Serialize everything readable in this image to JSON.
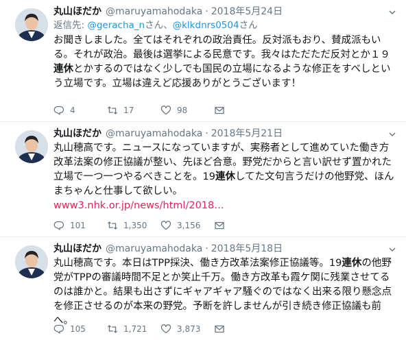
{
  "tweets": [
    {
      "name": "丸山ほだか",
      "handle": "@maruyamahodaka",
      "separator": "·",
      "date": "2018年5月24日",
      "reply_prefix": "返信先: ",
      "reply_mention_1": "@geracha_n",
      "reply_mid": "さん、",
      "reply_mention_2": "@klkdnrs0504",
      "reply_suffix": "さん",
      "text_1": "お聞きしました。全てはそれぞれの政治責任。反対派もおり、賛成派もいる。それが政治。最後は選挙による民意です。我々はただただ反対とか１９",
      "text_bold": "連休",
      "text_2": "とかするのではなく少しでも国民の立場になるような修正をすべしという立場です。立場は違えど応援ありがとうございます！",
      "link": "",
      "replies": "4",
      "retweets": "17",
      "likes": "98"
    },
    {
      "name": "丸山ほだか",
      "handle": "@maruyamahodaka",
      "separator": "·",
      "date": "2018年5月21日",
      "text_1": "丸山穂高です。ニュースになっていますが、実務者として進めていた働き方改革法案の修正協議が整い、先ほど合意。野党だからと言い訳せず置かれた立場で一つ一つやるべきことを。19",
      "text_bold": "連休",
      "text_2": "してた文句言うだけの他野党、ほんまちゃんと仕事して欲しい。",
      "link": "www3.nhk.or.jp/news/html/2018…",
      "replies": "101",
      "retweets": "1,350",
      "likes": "3,156"
    },
    {
      "name": "丸山ほだか",
      "handle": "@maruyamahodaka",
      "separator": "·",
      "date": "2018年5月18日",
      "text_1": "丸山穂高です。本日はTPP採決、働き方改革法案修正協議等。19",
      "text_bold": "連休",
      "text_2": "の他野党がTPPの審議時間不足とか笑止千万。働き方改革も霞ケ関に残業させてるのは誰かと。結果も出さずにギャアギャア騒ぐのではなく出来る限り懸念点を修正させるのが本来の野党。予断を許しませんが引き続き修正協議も前へ。",
      "link": "",
      "replies": "105",
      "retweets": "1,721",
      "likes": "3,873"
    }
  ],
  "colors": {
    "text": "#14171a",
    "muted": "#657786",
    "mention": "#1b95e0",
    "link": "#e0245e",
    "divider": "#e6ecf0"
  },
  "icons": [
    "avatar",
    "chevron-down-icon",
    "reply-icon",
    "retweet-icon",
    "like-icon",
    "message-icon"
  ]
}
